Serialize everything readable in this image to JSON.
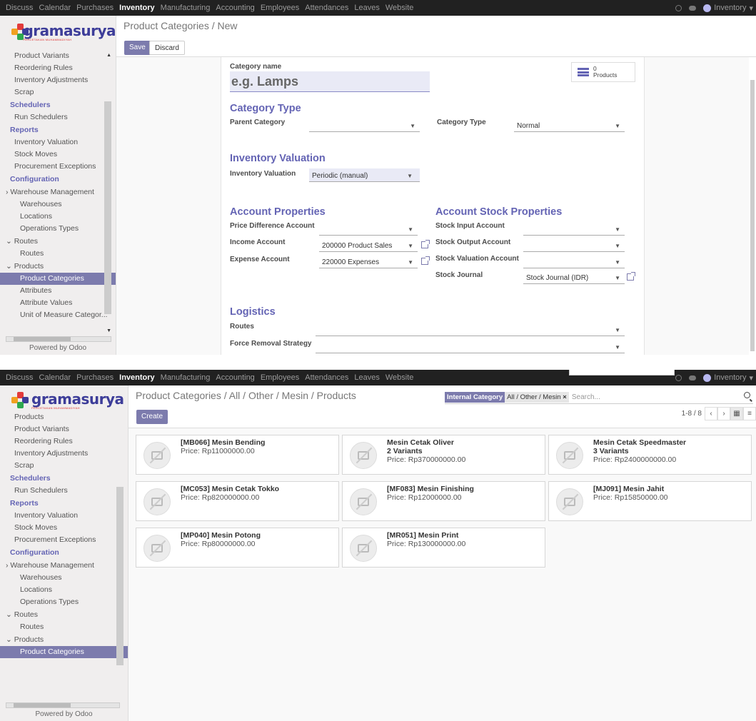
{
  "top_menu": [
    "Discuss",
    "Calendar",
    "Purchases",
    "Inventory",
    "Manufacturing",
    "Accounting",
    "Employees",
    "Attendances",
    "Leaves",
    "Website"
  ],
  "user_label": "Inventory",
  "logo": {
    "word": "gramasurya",
    "tagline": "PERCETAKAN MUHAMMADIYAH"
  },
  "sidebar_top": {
    "items": [
      {
        "t": "item",
        "label": "Product Variants"
      },
      {
        "t": "item",
        "label": "Reordering Rules"
      },
      {
        "t": "item",
        "label": "Inventory Adjustments"
      },
      {
        "t": "item",
        "label": "Scrap"
      },
      {
        "t": "head",
        "label": "Schedulers"
      },
      {
        "t": "item",
        "label": "Run Schedulers"
      },
      {
        "t": "head",
        "label": "Reports"
      },
      {
        "t": "item",
        "label": "Inventory Valuation"
      },
      {
        "t": "item",
        "label": "Stock Moves"
      },
      {
        "t": "item",
        "label": "Procurement Exceptions"
      },
      {
        "t": "head",
        "label": "Configuration"
      },
      {
        "t": "grp",
        "label": "› Warehouse Management"
      },
      {
        "t": "sub",
        "label": "Warehouses"
      },
      {
        "t": "sub",
        "label": "Locations"
      },
      {
        "t": "sub",
        "label": "Operations Types"
      },
      {
        "t": "grp",
        "label": "⌄ Routes"
      },
      {
        "t": "sub",
        "label": "Routes"
      },
      {
        "t": "grp",
        "label": "⌄ Products"
      },
      {
        "t": "sel",
        "label": "Product Categories"
      },
      {
        "t": "sub",
        "label": "Attributes"
      },
      {
        "t": "sub",
        "label": "Attribute Values"
      },
      {
        "t": "sub",
        "label": "Unit of Measure Categor..."
      }
    ],
    "footer": "Powered by Odoo"
  },
  "form": {
    "breadcrumb": "Product Categories / New",
    "save": "Save",
    "discard": "Discard",
    "category_name_label": "Category name",
    "category_name_placeholder": "e.g. Lamps",
    "smart_count": "0",
    "smart_label": "Products",
    "sec_category_type": "Category Type",
    "parent_category_label": "Parent Category",
    "category_type_label": "Category Type",
    "category_type_value": "Normal",
    "sec_inventory_valuation": "Inventory Valuation",
    "inventory_valuation_label": "Inventory Valuation",
    "inventory_valuation_value": "Periodic (manual)",
    "sec_account_properties": "Account Properties",
    "sec_account_stock": "Account Stock Properties",
    "price_diff_label": "Price Difference Account",
    "income_label": "Income Account",
    "income_value": "200000 Product Sales",
    "expense_label": "Expense Account",
    "expense_value": "220000 Expenses",
    "stock_input_label": "Stock Input Account",
    "stock_output_label": "Stock Output Account",
    "stock_valuation_label": "Stock Valuation Account",
    "stock_journal_label": "Stock Journal",
    "stock_journal_value": "Stock Journal (IDR)",
    "sec_logistics": "Logistics",
    "routes_label": "Routes",
    "force_removal_label": "Force Removal Strategy"
  },
  "sidebar_bottom": {
    "items": [
      {
        "t": "item",
        "label": "Products"
      },
      {
        "t": "item",
        "label": "Product Variants"
      },
      {
        "t": "item",
        "label": "Reordering Rules"
      },
      {
        "t": "item",
        "label": "Inventory Adjustments"
      },
      {
        "t": "item",
        "label": "Scrap"
      },
      {
        "t": "head",
        "label": "Schedulers"
      },
      {
        "t": "item",
        "label": "Run Schedulers"
      },
      {
        "t": "head",
        "label": "Reports"
      },
      {
        "t": "item",
        "label": "Inventory Valuation"
      },
      {
        "t": "item",
        "label": "Stock Moves"
      },
      {
        "t": "item",
        "label": "Procurement Exceptions"
      },
      {
        "t": "head",
        "label": "Configuration"
      },
      {
        "t": "grp",
        "label": "› Warehouse Management"
      },
      {
        "t": "sub",
        "label": "Warehouses"
      },
      {
        "t": "sub",
        "label": "Locations"
      },
      {
        "t": "sub",
        "label": "Operations Types"
      },
      {
        "t": "grp",
        "label": "⌄ Routes"
      },
      {
        "t": "sub",
        "label": "Routes"
      },
      {
        "t": "grp",
        "label": "⌄ Products"
      },
      {
        "t": "sel",
        "label": "Product Categories"
      }
    ],
    "footer": "Powered by Odoo"
  },
  "kanban": {
    "breadcrumb": "Product Categories / All / Other / Mesin / Products",
    "facet_key": "Internal Category",
    "facet_value": "All / Other / Mesin",
    "facet_close": "×",
    "search_placeholder": "Search...",
    "create": "Create",
    "pager": "1-8 / 8",
    "cards": [
      {
        "name": "[MB066] Mesin Bending",
        "variants": "",
        "price": "Price: Rp11000000.00"
      },
      {
        "name": "Mesin Cetak Oliver",
        "variants": "2 Variants",
        "price": "Price: Rp370000000.00"
      },
      {
        "name": "Mesin Cetak Speedmaster",
        "variants": "3 Variants",
        "price": "Price: Rp2400000000.00"
      },
      {
        "name": "[MC053] Mesin Cetak Tokko",
        "variants": "",
        "price": "Price: Rp820000000.00"
      },
      {
        "name": "[MF083] Mesin Finishing",
        "variants": "",
        "price": "Price: Rp12000000.00"
      },
      {
        "name": "[MJ091] Mesin Jahit",
        "variants": "",
        "price": "Price: Rp15850000.00"
      },
      {
        "name": "[MP040] Mesin Potong",
        "variants": "",
        "price": "Price: Rp80000000.00"
      },
      {
        "name": "[MR051] Mesin Print",
        "variants": "",
        "price": "Price: Rp130000000.00"
      }
    ]
  },
  "colors": {
    "accent": "#7c7bad",
    "section": "#6464b4",
    "topbar": "#212121"
  }
}
